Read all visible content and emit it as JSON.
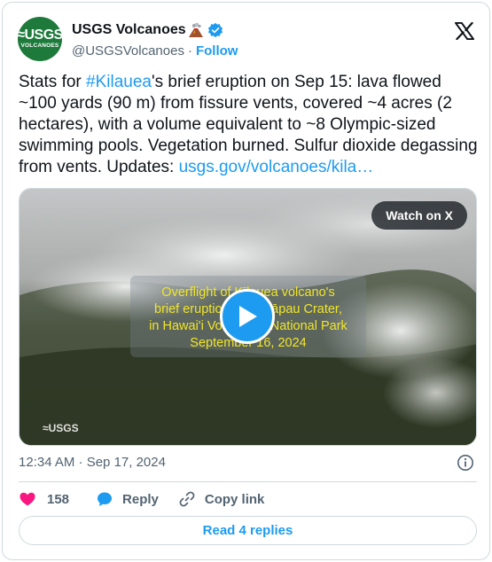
{
  "author": {
    "display_name": "USGS Volcanoes",
    "handle": "@USGSVolcanoes",
    "separator": "·",
    "follow_label": "Follow",
    "avatar_text_top": "≈USGS",
    "avatar_text_bottom": "VOLCANOES",
    "avatar_color": "#1d7a3b",
    "verified_color": "#1d9bf0"
  },
  "tweet": {
    "text_before": "Stats for ",
    "hashtag": "#Kilauea",
    "text_after": "'s brief eruption on Sep 15: lava flowed ~100 yards (90 m) from fissure vents, covered ~4 acres (2 hectares), with a volume equivalent to ~8 Olympic-sized swimming pools. Vegetation burned. Sulfur dioxide degassing from vents. Updates: ",
    "link": "usgs.gov/volcanoes/kila…"
  },
  "media": {
    "watch_label": "Watch on X",
    "overlay_lines": [
      "Overflight of Kīlauea volcano's",
      "brief eruption near Nāpau Crater,",
      "in Hawai'i Volcanoes National Park",
      "September 16, 2024"
    ],
    "watermark": "≈USGS",
    "play_icon": "play-icon"
  },
  "meta": {
    "timestamp": "12:34 AM · Sep 17, 2024"
  },
  "actions": {
    "like_count": "158",
    "reply_label": "Reply",
    "copy_label": "Copy link",
    "read_replies_label": "Read 4 replies"
  },
  "colors": {
    "link": "#1d9bf0",
    "like": "#f91880",
    "overlay_text": "#f0e52b",
    "muted": "#536471"
  }
}
